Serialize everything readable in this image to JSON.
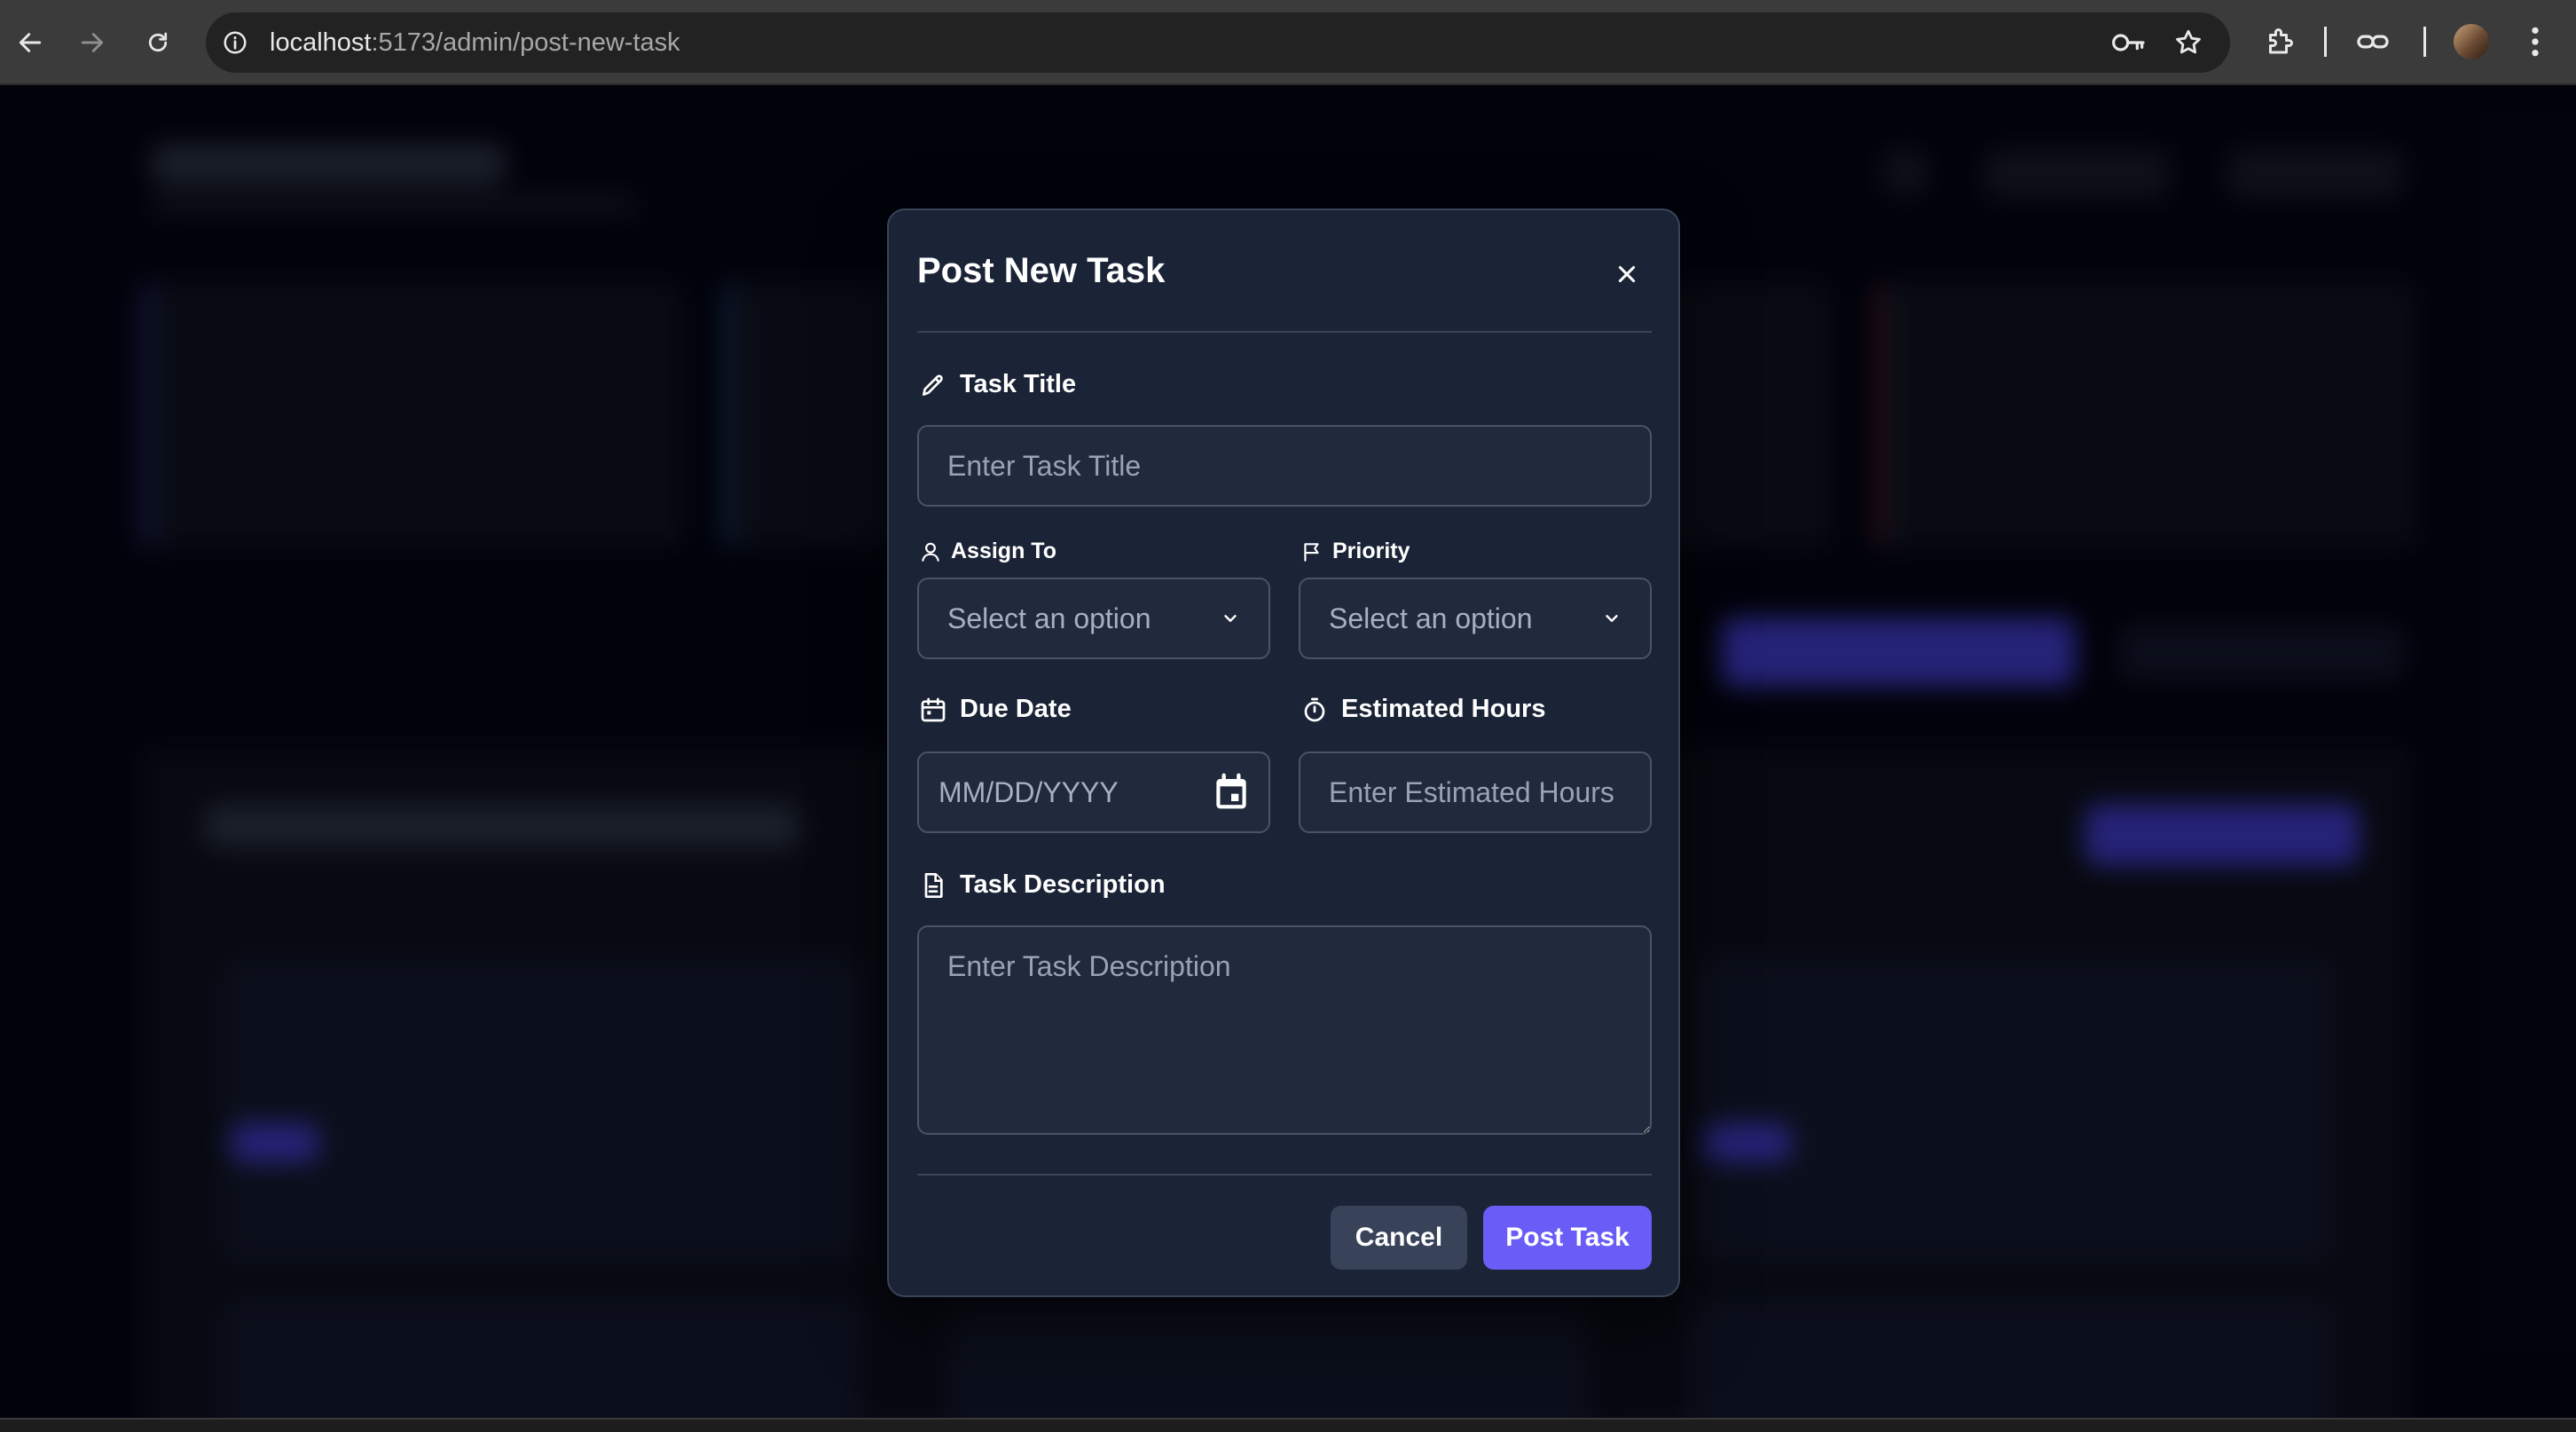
{
  "browser": {
    "url_host": "localhost",
    "url_path": ":5173/admin/post-new-task",
    "icons": [
      "back-icon",
      "forward-icon",
      "reload-icon",
      "site-info-icon",
      "password-key-icon",
      "bookmark-star-icon",
      "extensions-icon",
      "link-icon",
      "profile-avatar",
      "more-menu-icon"
    ]
  },
  "modal": {
    "title": "Post New Task",
    "task_title": {
      "label": "Task Title",
      "placeholder": "Enter Task Title",
      "value": ""
    },
    "assign_to": {
      "label": "Assign To",
      "selected": "Select an option"
    },
    "priority": {
      "label": "Priority",
      "selected": "Select an option"
    },
    "due_date": {
      "label": "Due Date",
      "placeholder": "MM/DD/YYYY"
    },
    "estimated_hours": {
      "label": "Estimated Hours",
      "placeholder": "Enter Estimated Hours",
      "value": ""
    },
    "task_description": {
      "label": "Task Description",
      "placeholder": "Enter Task Description",
      "value": ""
    },
    "cancel_label": "Cancel",
    "submit_label": "Post Task"
  },
  "colors": {
    "modal_bg": "#1b2436",
    "field_bg": "#202a3c",
    "primary": "#6a5cf6",
    "cancel": "#38435a",
    "backdrop": "#030512"
  }
}
